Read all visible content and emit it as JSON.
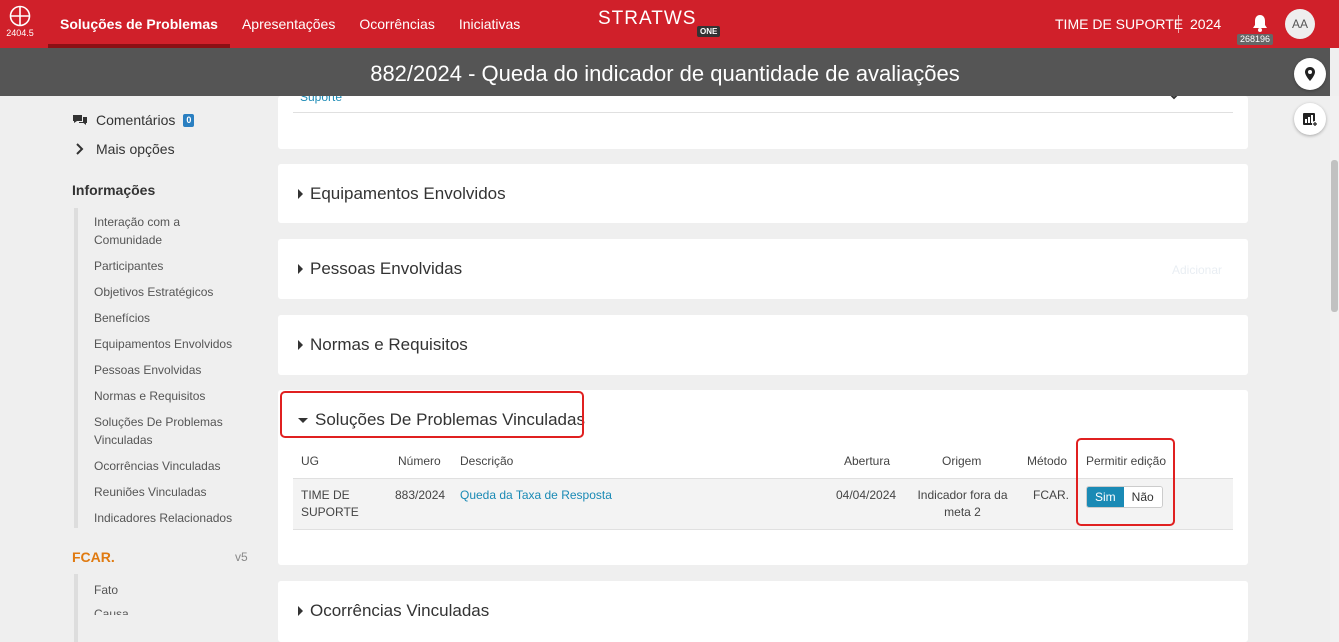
{
  "topbar": {
    "version": "2404.5",
    "nav": [
      "Soluções de Problemas",
      "Apresentações",
      "Ocorrências",
      "Iniciativas"
    ],
    "brand": "STRATWS",
    "brand_sub": "ONE",
    "team": "TIME DE SUPORTE",
    "year": "2024",
    "notification_count": "268196",
    "avatar_initials": "AA"
  },
  "page_title": "882/2024 - Queda do indicador de quantidade de avaliações",
  "sidebar": {
    "comments_label": "Comentários",
    "comments_count": "0",
    "more_options": "Mais opções",
    "info_heading": "Informações",
    "info_items": [
      "Interação com a Comunidade",
      "Participantes",
      "Objetivos Estratégicos",
      "Benefícios",
      "Equipamentos Envolvidos",
      "Pessoas Envolvidas",
      "Normas e Requisitos",
      "Soluções De Problemas Vinculadas",
      "Ocorrências Vinculadas",
      "Reuniões Vinculadas",
      "Indicadores Relacionados"
    ],
    "fcar_heading": "FCAR.",
    "fcar_version": "v5",
    "fcar_items": [
      "Fato",
      "Causa"
    ]
  },
  "top_card": {
    "partial_text": "Suporte"
  },
  "sections": {
    "equipamentos": "Equipamentos Envolvidos",
    "pessoas": "Pessoas Envolvidas",
    "pessoas_add": "Adicionar",
    "normas": "Normas e Requisitos",
    "solucoes": "Soluções De Problemas Vinculadas",
    "ocorrencias": "Ocorrências Vinculadas"
  },
  "table": {
    "headers": [
      "UG",
      "Número",
      "Descrição",
      "Abertura",
      "Origem",
      "Método",
      "Permitir edição"
    ],
    "rows": [
      {
        "ug": "TIME DE SUPORTE",
        "numero": "883/2024",
        "descricao": "Queda da Taxa de Resposta",
        "abertura": "04/04/2024",
        "origem": "Indicador fora da meta 2",
        "metodo": "FCAR.",
        "toggle_yes": "Sim",
        "toggle_no": "Não",
        "permitir_edicao": "Sim"
      }
    ]
  },
  "colors": {
    "brand_red": "#d0202a",
    "title_bar": "#555555",
    "link_blue": "#1a8ab5",
    "fcar_orange": "#e07a10",
    "highlight_red": "#e02020"
  }
}
